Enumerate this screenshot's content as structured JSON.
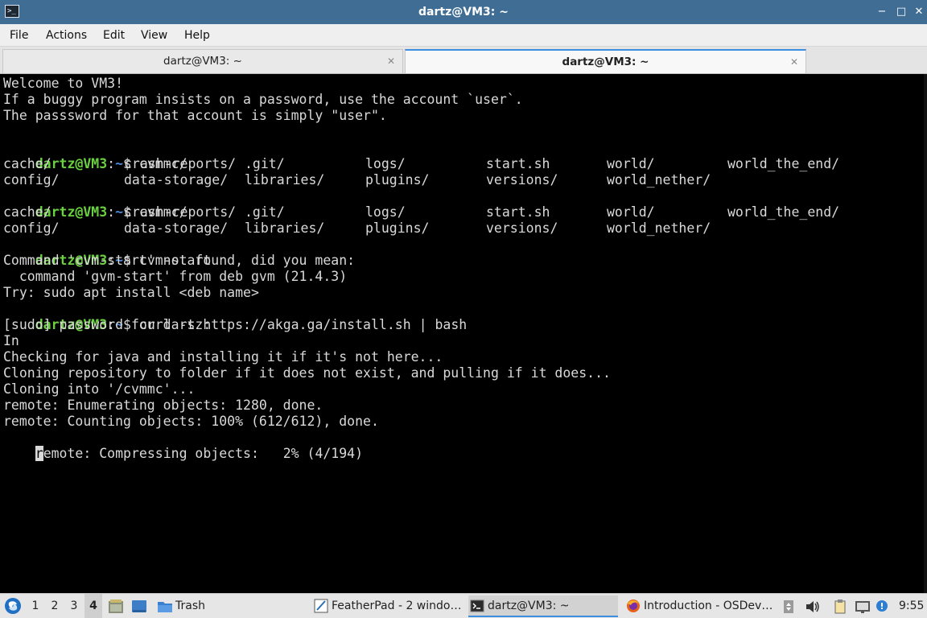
{
  "window": {
    "title": "dartz@VM3: ~",
    "minimize": "−",
    "maximize": "□",
    "close": "✕"
  },
  "menu": [
    "File",
    "Actions",
    "Edit",
    "View",
    "Help"
  ],
  "tabs": [
    {
      "label": "dartz@VM3: ~",
      "active": false,
      "close": "✕"
    },
    {
      "label": "dartz@VM3: ~",
      "active": true,
      "close": "✕"
    }
  ],
  "terminal": {
    "prompt_user": "dartz@VM3",
    "prompt_sep": ":",
    "prompt_path": "~",
    "prompt_symbol": "$ ",
    "motd": [
      "Welcome to VM3!",
      "If a buggy program insists on a password, use the account `user`.",
      "The passsword for that account is simply \"user\"."
    ],
    "cmd1": "cvmmc/",
    "ls_row1": [
      "cache/",
      "crash-reports/",
      ".git/",
      "logs/",
      "start.sh",
      "world/",
      "world_the_end/"
    ],
    "ls_row2": [
      "config/",
      "data-storage/",
      "libraries/",
      "plugins/",
      "versions/",
      "world_nether/"
    ],
    "cmd2": "cvmmc/",
    "cmd3": "cvm-start",
    "not_found": [
      "Command 'cvm-start' not found, did you mean:",
      "  command 'gvm-start' from deb gvm (21.4.3)",
      "Try: sudo apt install <deb name>"
    ],
    "cmd4": "curl -s https://akga.ga/install.sh | bash",
    "output": [
      "[sudo] password for dartz:",
      "In",
      "Checking for java and installing it if it's not here...",
      "Cloning repository to folder if it does not exist, and pulling if it does...",
      "Cloning into '/cvmmc'...",
      "remote: Enumerating objects: 1280, done.",
      "remote: Counting objects: 100% (612/612), done."
    ],
    "last_line_cursor_char": "r",
    "last_line_rest": "emote: Compressing objects:   2% (4/194)"
  },
  "taskbar": {
    "workspaces": [
      "1",
      "2",
      "3",
      "4"
    ],
    "active_workspace": "4",
    "launchers": [
      "Trash"
    ],
    "tasks": [
      {
        "label": "FeatherPad - 2 windo…",
        "icon": "featherpad-icon",
        "active": false
      },
      {
        "label": "dartz@VM3: ~",
        "icon": "terminal-icon",
        "active": true
      },
      {
        "label": "Introduction - OSDev…",
        "icon": "firefox-icon",
        "active": false
      }
    ],
    "clock": "9:55"
  },
  "colors": {
    "titlebar": "#3f6d94",
    "prompt_user": "#6ad13e",
    "prompt_path": "#4b8ad6",
    "terminal_bg": "#000000",
    "terminal_fg": "#d9d9d9"
  }
}
